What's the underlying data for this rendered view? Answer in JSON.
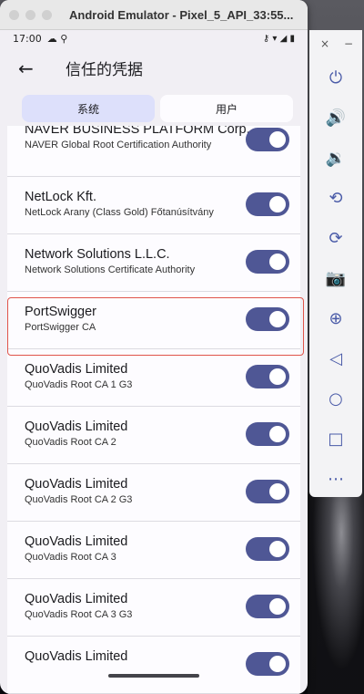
{
  "window": {
    "title": "Android Emulator - Pixel_5_API_33:55..."
  },
  "statusbar": {
    "time": "17:00",
    "left_icons": "☁ ⚲",
    "right_icons": "⚷ ▾ ◢ ▮"
  },
  "appbar": {
    "back": "←",
    "title": "信任的凭据"
  },
  "tabs": [
    {
      "label": "系统"
    },
    {
      "label": "用户"
    }
  ],
  "certs": [
    {
      "name": "NAVER BUSINESS PLATFORM Corp.",
      "sub": "NAVER Global Root Certification Authority",
      "enabled": true
    },
    {
      "name": "NetLock Kft.",
      "sub": "NetLock Arany (Class Gold) Főtanúsítvány",
      "enabled": true
    },
    {
      "name": "Network Solutions L.L.C.",
      "sub": "Network Solutions Certificate Authority",
      "enabled": true
    },
    {
      "name": "PortSwigger",
      "sub": "PortSwigger CA",
      "enabled": true
    },
    {
      "name": "QuoVadis Limited",
      "sub": "QuoVadis Root CA 1 G3",
      "enabled": true
    },
    {
      "name": "QuoVadis Limited",
      "sub": "QuoVadis Root CA 2",
      "enabled": true
    },
    {
      "name": "QuoVadis Limited",
      "sub": "QuoVadis Root CA 2 G3",
      "enabled": true
    },
    {
      "name": "QuoVadis Limited",
      "sub": "QuoVadis Root CA 3",
      "enabled": true
    },
    {
      "name": "QuoVadis Limited",
      "sub": "QuoVadis Root CA 3 G3",
      "enabled": true
    },
    {
      "name": "QuoVadis Limited",
      "sub": "",
      "enabled": true
    }
  ],
  "sidepanel": {
    "close": "×",
    "minimize": "−",
    "buttons": [
      {
        "name": "power-icon",
        "glyph": "⏻"
      },
      {
        "name": "volume-up-icon",
        "glyph": "🔊"
      },
      {
        "name": "volume-down-icon",
        "glyph": "🔉"
      },
      {
        "name": "rotate-left-icon",
        "glyph": "⟲"
      },
      {
        "name": "rotate-right-icon",
        "glyph": "⟳"
      },
      {
        "name": "camera-icon",
        "glyph": "📷"
      },
      {
        "name": "zoom-icon",
        "glyph": "⊕"
      },
      {
        "name": "back-icon",
        "glyph": "◁"
      },
      {
        "name": "home-icon",
        "glyph": "○"
      },
      {
        "name": "overview-icon",
        "glyph": "□"
      },
      {
        "name": "more-icon",
        "glyph": "⋯"
      }
    ]
  },
  "colors": {
    "toggle_on": "#4f5795",
    "tab_active": "#dde0fb",
    "highlight": "#e0544a"
  }
}
